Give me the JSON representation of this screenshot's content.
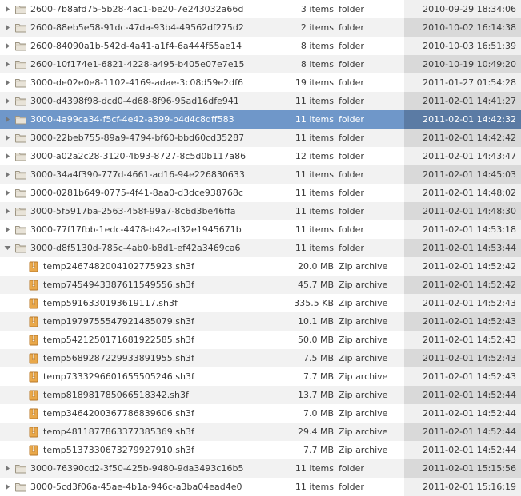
{
  "rows": [
    {
      "twist": "closed",
      "indent": 0,
      "icon": "folder",
      "name": "2600-7b8afd75-5b28-4ac1-be20-7e243032a66d",
      "size": "3 items",
      "type": "folder",
      "date": "2010-09-29 18:34:06",
      "selected": false
    },
    {
      "twist": "closed",
      "indent": 0,
      "icon": "folder",
      "name": "2600-88eb5e58-91dc-47da-93b4-49562df275d2",
      "size": "2 items",
      "type": "folder",
      "date": "2010-10-02 16:14:38",
      "selected": false
    },
    {
      "twist": "closed",
      "indent": 0,
      "icon": "folder",
      "name": "2600-84090a1b-542d-4a41-a1f4-6a444f55ae14",
      "size": "8 items",
      "type": "folder",
      "date": "2010-10-03 16:51:39",
      "selected": false
    },
    {
      "twist": "closed",
      "indent": 0,
      "icon": "folder",
      "name": "2600-10f174e1-6821-4228-a495-b405e07e7e15",
      "size": "8 items",
      "type": "folder",
      "date": "2010-10-19 10:49:20",
      "selected": false
    },
    {
      "twist": "closed",
      "indent": 0,
      "icon": "folder",
      "name": "3000-de02e0e8-1102-4169-adae-3c08d59e2df6",
      "size": "19 items",
      "type": "folder",
      "date": "2011-01-27 01:54:28",
      "selected": false
    },
    {
      "twist": "closed",
      "indent": 0,
      "icon": "folder",
      "name": "3000-d4398f98-dcd0-4d68-8f96-95ad16dfe941",
      "size": "11 items",
      "type": "folder",
      "date": "2011-02-01 14:41:27",
      "selected": false
    },
    {
      "twist": "closed",
      "indent": 0,
      "icon": "folder",
      "name": "3000-4a99ca34-f5cf-4e42-a399-b4d4c8dff583",
      "size": "11 items",
      "type": "folder",
      "date": "2011-02-01 14:42:32",
      "selected": true
    },
    {
      "twist": "closed",
      "indent": 0,
      "icon": "folder",
      "name": "3000-22beb755-89a9-4794-bf60-bbd60cd35287",
      "size": "11 items",
      "type": "folder",
      "date": "2011-02-01 14:42:42",
      "selected": false
    },
    {
      "twist": "closed",
      "indent": 0,
      "icon": "folder",
      "name": "3000-a02a2c28-3120-4b93-8727-8c5d0b117a86",
      "size": "12 items",
      "type": "folder",
      "date": "2011-02-01 14:43:47",
      "selected": false
    },
    {
      "twist": "closed",
      "indent": 0,
      "icon": "folder",
      "name": "3000-34a4f390-777d-4661-ad16-94e226830633",
      "size": "11 items",
      "type": "folder",
      "date": "2011-02-01 14:45:03",
      "selected": false
    },
    {
      "twist": "closed",
      "indent": 0,
      "icon": "folder",
      "name": "3000-0281b649-0775-4f41-8aa0-d3dce938768c",
      "size": "11 items",
      "type": "folder",
      "date": "2011-02-01 14:48:02",
      "selected": false
    },
    {
      "twist": "closed",
      "indent": 0,
      "icon": "folder",
      "name": "3000-5f5917ba-2563-458f-99a7-8c6d3be46ffa",
      "size": "11 items",
      "type": "folder",
      "date": "2011-02-01 14:48:30",
      "selected": false
    },
    {
      "twist": "closed",
      "indent": 0,
      "icon": "folder",
      "name": "3000-77f17fbb-1edc-4478-b42a-d32e1945671b",
      "size": "11 items",
      "type": "folder",
      "date": "2011-02-01 14:53:18",
      "selected": false
    },
    {
      "twist": "open",
      "indent": 0,
      "icon": "folder",
      "name": "3000-d8f5130d-785c-4ab0-b8d1-ef42a3469ca6",
      "size": "11 items",
      "type": "folder",
      "date": "2011-02-01 14:53:44",
      "selected": false
    },
    {
      "twist": "none",
      "indent": 1,
      "icon": "zip",
      "name": "temp2467482004102775923.sh3f",
      "size": "20.0 MB",
      "type": "Zip archive",
      "date": "2011-02-01 14:52:42",
      "selected": false
    },
    {
      "twist": "none",
      "indent": 1,
      "icon": "zip",
      "name": "temp7454943387611549556.sh3f",
      "size": "45.7 MB",
      "type": "Zip archive",
      "date": "2011-02-01 14:52:42",
      "selected": false
    },
    {
      "twist": "none",
      "indent": 1,
      "icon": "zip",
      "name": "temp5916330193619117.sh3f",
      "size": "335.5 KB",
      "type": "Zip archive",
      "date": "2011-02-01 14:52:43",
      "selected": false
    },
    {
      "twist": "none",
      "indent": 1,
      "icon": "zip",
      "name": "temp1979755547921485079.sh3f",
      "size": "10.1 MB",
      "type": "Zip archive",
      "date": "2011-02-01 14:52:43",
      "selected": false
    },
    {
      "twist": "none",
      "indent": 1,
      "icon": "zip",
      "name": "temp5421250171681922585.sh3f",
      "size": "50.0 MB",
      "type": "Zip archive",
      "date": "2011-02-01 14:52:43",
      "selected": false
    },
    {
      "twist": "none",
      "indent": 1,
      "icon": "zip",
      "name": "temp5689287229933891955.sh3f",
      "size": "7.5 MB",
      "type": "Zip archive",
      "date": "2011-02-01 14:52:43",
      "selected": false
    },
    {
      "twist": "none",
      "indent": 1,
      "icon": "zip",
      "name": "temp7333296601655505246.sh3f",
      "size": "7.7 MB",
      "type": "Zip archive",
      "date": "2011-02-01 14:52:43",
      "selected": false
    },
    {
      "twist": "none",
      "indent": 1,
      "icon": "zip",
      "name": "temp818981785066518342.sh3f",
      "size": "13.7 MB",
      "type": "Zip archive",
      "date": "2011-02-01 14:52:44",
      "selected": false
    },
    {
      "twist": "none",
      "indent": 1,
      "icon": "zip",
      "name": "temp3464200367786839606.sh3f",
      "size": "7.0 MB",
      "type": "Zip archive",
      "date": "2011-02-01 14:52:44",
      "selected": false
    },
    {
      "twist": "none",
      "indent": 1,
      "icon": "zip",
      "name": "temp4811877863377385369.sh3f",
      "size": "29.4 MB",
      "type": "Zip archive",
      "date": "2011-02-01 14:52:44",
      "selected": false
    },
    {
      "twist": "none",
      "indent": 1,
      "icon": "zip",
      "name": "temp5137330673279927910.sh3f",
      "size": "7.7 MB",
      "type": "Zip archive",
      "date": "2011-02-01 14:52:44",
      "selected": false
    },
    {
      "twist": "closed",
      "indent": 0,
      "icon": "folder",
      "name": "3000-76390cd2-3f50-425b-9480-9da3493c16b5",
      "size": "11 items",
      "type": "folder",
      "date": "2011-02-01 15:15:56",
      "selected": false
    },
    {
      "twist": "closed",
      "indent": 0,
      "icon": "folder",
      "name": "3000-5cd3f06a-45ae-4b1a-946c-a3ba04ead4e0",
      "size": "11 items",
      "type": "folder",
      "date": "2011-02-01 15:16:19",
      "selected": false
    }
  ]
}
